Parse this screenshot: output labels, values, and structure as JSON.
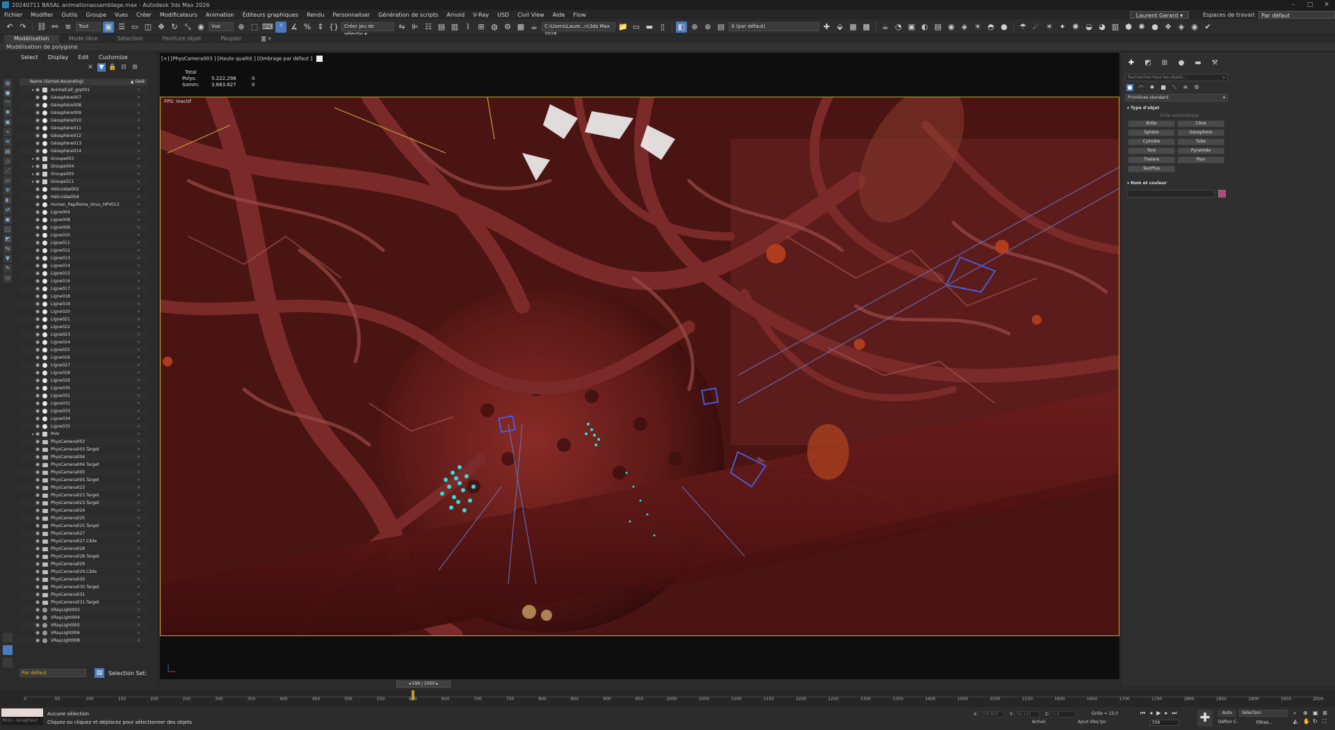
{
  "titlebar": {
    "title": "20240711 BASAL animationassamblage.max - Autodesk 3ds Max 2026",
    "controls": [
      "–",
      "□",
      "✕"
    ]
  },
  "menubar": {
    "items": [
      "Fichier",
      "Modifier",
      "Outils",
      "Groupe",
      "Vues",
      "Créer",
      "Modificateurs",
      "Animation",
      "Éditeurs graphiques",
      "Rendu",
      "Personnaliser",
      "Génération de scripts",
      "Arnold",
      "V-Ray",
      "USD",
      "Civil View",
      "Aide",
      "Flow"
    ],
    "user": "Laurent Gerard ▾",
    "workspace_label": "Espaces de travail:",
    "workspace_value": "Par défaut"
  },
  "toolbar": {
    "selection_filter": "Tout",
    "ref_coord": "Vue",
    "named_sel_set": "Créer jeu de sélectio ▾",
    "project_path": "C:\\Users\\Laure...n\\3ds Max 2026",
    "layer_value": "0 (par défaut)"
  },
  "ribbon": {
    "tabs": [
      "Modélisation",
      "Mode libre",
      "Sélection",
      "Peinture objet",
      "Peupler"
    ],
    "active_tab": "Modélisation",
    "subpanel": "Modélisation de polygone"
  },
  "explorer": {
    "menu": [
      "Select",
      "Display",
      "Edit",
      "Customize"
    ],
    "header_name": "Name (Sorted Ascending)",
    "header_frozen": "▲ Gelé",
    "items": [
      {
        "name": "AnimalCell_grp001",
        "type": "grp",
        "expandable": true
      },
      {
        "name": "Géosphère007",
        "type": "geo"
      },
      {
        "name": "Géosphère008",
        "type": "geo"
      },
      {
        "name": "Géosphère009",
        "type": "geo"
      },
      {
        "name": "Géosphère010",
        "type": "geo"
      },
      {
        "name": "Géosphère011",
        "type": "geo"
      },
      {
        "name": "Géosphère012",
        "type": "geo"
      },
      {
        "name": "Géosphère013",
        "type": "geo"
      },
      {
        "name": "Géosphère014",
        "type": "geo"
      },
      {
        "name": "Groupe003",
        "type": "grp",
        "expandable": true
      },
      {
        "name": "Groupe004",
        "type": "grp",
        "expandable": true
      },
      {
        "name": "Groupe005",
        "type": "grp",
        "expandable": true
      },
      {
        "name": "Groupe511",
        "type": "grp",
        "expandable": true
      },
      {
        "name": "Hélicoïdal002",
        "type": "geo"
      },
      {
        "name": "Hélicoïdal004",
        "type": "geo"
      },
      {
        "name": "Human_Papilloma_Virus_HPV013",
        "type": "geo"
      },
      {
        "name": "Ligne004",
        "type": "geo"
      },
      {
        "name": "Ligne008",
        "type": "geo"
      },
      {
        "name": "Ligne009",
        "type": "geo"
      },
      {
        "name": "Ligne010",
        "type": "geo"
      },
      {
        "name": "Ligne011",
        "type": "geo"
      },
      {
        "name": "Ligne012",
        "type": "geo"
      },
      {
        "name": "Ligne013",
        "type": "geo"
      },
      {
        "name": "Ligne014",
        "type": "geo"
      },
      {
        "name": "Ligne015",
        "type": "geo"
      },
      {
        "name": "Ligne016",
        "type": "geo"
      },
      {
        "name": "Ligne017",
        "type": "geo"
      },
      {
        "name": "Ligne018",
        "type": "geo"
      },
      {
        "name": "Ligne019",
        "type": "geo"
      },
      {
        "name": "Ligne020",
        "type": "geo"
      },
      {
        "name": "Ligne021",
        "type": "geo"
      },
      {
        "name": "Ligne022",
        "type": "geo"
      },
      {
        "name": "Ligne023",
        "type": "geo"
      },
      {
        "name": "Ligne024",
        "type": "geo"
      },
      {
        "name": "Ligne025",
        "type": "geo"
      },
      {
        "name": "Ligne026",
        "type": "geo"
      },
      {
        "name": "Ligne027",
        "type": "geo"
      },
      {
        "name": "Ligne028",
        "type": "geo"
      },
      {
        "name": "Ligne029",
        "type": "geo"
      },
      {
        "name": "Ligne030",
        "type": "geo"
      },
      {
        "name": "Ligne031",
        "type": "geo"
      },
      {
        "name": "Ligne032",
        "type": "geo"
      },
      {
        "name": "Ligne033",
        "type": "geo"
      },
      {
        "name": "Ligne034",
        "type": "geo"
      },
      {
        "name": "Ligne035",
        "type": "geo"
      },
      {
        "name": "PHV",
        "type": "grp",
        "expandable": true
      },
      {
        "name": "PhysCamera003",
        "type": "cam"
      },
      {
        "name": "PhysCamera003.Target",
        "type": "cam"
      },
      {
        "name": "PhysCamera004",
        "type": "cam"
      },
      {
        "name": "PhysCamera004.Target",
        "type": "cam"
      },
      {
        "name": "PhysCamera005",
        "type": "cam"
      },
      {
        "name": "PhysCamera005.Target",
        "type": "cam"
      },
      {
        "name": "PhysCamera023",
        "type": "cam"
      },
      {
        "name": "PhysCamera023.Target",
        "type": "cam"
      },
      {
        "name": "PhysCamera023.Target",
        "type": "cam"
      },
      {
        "name": "PhysCamera024",
        "type": "cam"
      },
      {
        "name": "PhysCamera025",
        "type": "cam"
      },
      {
        "name": "PhysCamera025.Target",
        "type": "cam"
      },
      {
        "name": "PhysCamera027",
        "type": "cam"
      },
      {
        "name": "PhysCamera027.Cible",
        "type": "cam"
      },
      {
        "name": "PhysCamera028",
        "type": "cam"
      },
      {
        "name": "PhysCamera028.Target",
        "type": "cam"
      },
      {
        "name": "PhysCamera029",
        "type": "cam"
      },
      {
        "name": "PhysCamera029.Cible",
        "type": "cam"
      },
      {
        "name": "PhysCamera030",
        "type": "cam"
      },
      {
        "name": "PhysCamera030.Target",
        "type": "cam"
      },
      {
        "name": "PhysCamera031",
        "type": "cam"
      },
      {
        "name": "PhysCamera031.Target",
        "type": "cam"
      },
      {
        "name": "VRayLight003",
        "type": "lit"
      },
      {
        "name": "VRayLight004",
        "type": "lit"
      },
      {
        "name": "VRayLight005",
        "type": "lit"
      },
      {
        "name": "VRayLight006",
        "type": "lit"
      },
      {
        "name": "VRayLight008",
        "type": "lit"
      }
    ],
    "layer": "Par défaut",
    "selection_set_label": "Selection Set:"
  },
  "viewport": {
    "label": "[+] [PhysCamera003 ] [Haute qualité ] [Ombrage par défaut ]",
    "stats_title": "Total",
    "polys_label": "Polys:",
    "polys_value": "5.222.298",
    "polys_sel": "0",
    "verts_label": "Somm:",
    "verts_value": "3.683.827",
    "verts_sel": "0",
    "fps": "FPS:    Inactif"
  },
  "command_panel": {
    "search_placeholder": "Rechercher tous les objets...",
    "category": "Primitives standard",
    "object_type_title": "Type d'objet",
    "autogrid": "Grille automatique",
    "buttons": [
      "Boîte",
      "Cône",
      "Sphère",
      "Géosphère",
      "Cylindre",
      "Tube",
      "Tore",
      "Pyramide",
      "Théière",
      "Plan",
      "TextPlus"
    ],
    "name_color_title": "Nom et couleur",
    "color": "#b8447a"
  },
  "timeline": {
    "frame_display": "599 / 2000",
    "ticks": [
      "0",
      "50",
      "100",
      "150",
      "200",
      "250",
      "300",
      "350",
      "400",
      "450",
      "500",
      "550",
      "600",
      "650",
      "700",
      "750",
      "800",
      "850",
      "900",
      "950",
      "1000",
      "1050",
      "1100",
      "1150",
      "1200",
      "1250",
      "1300",
      "1350",
      "1400",
      "1450",
      "1500",
      "1550",
      "1600",
      "1650",
      "1700",
      "1750",
      "1800",
      "1850",
      "1900",
      "1950",
      "2000"
    ]
  },
  "statusbar": {
    "mini_listener": "Mini-récepteur",
    "status_line1": "Aucune sélection",
    "status_line2": "Cliquez ou cliquez et déplacez pour sélectionner des objets",
    "x_label": "X:",
    "x_value": "236,863",
    "y_label": "Y:",
    "y_value": "56,142",
    "z_label": "Z:",
    "z_value": "0,0",
    "grid": "Grille = 10,0",
    "active_label": "Activé:",
    "add_time": "Ajout dlsq tpc",
    "current_frame": "599",
    "auto_btn": "Auto",
    "define_key": "Définir C.",
    "selection_dropdown": "Sélection",
    "filters": "Filtres..."
  }
}
